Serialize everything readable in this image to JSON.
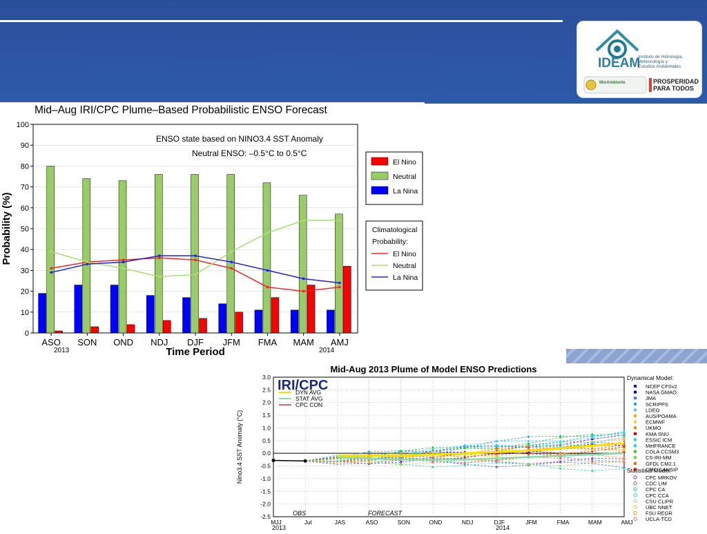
{
  "logo": {
    "org_short": "IDEAM",
    "org_long_line1": "Instituto de Hidrología,",
    "org_long_line2": "Meteorología y",
    "org_long_line3": "Estudios Ambientales",
    "ministry": "MinAmbiente",
    "slogan_line1": "PROSPERIDAD",
    "slogan_line2": "PARA TODOS"
  },
  "colors": {
    "el_nino": "#ff0000",
    "neutral": "#99cc66",
    "la_nina": "#0000ff",
    "header": "#2e56a6"
  },
  "chart_data": [
    {
      "type": "bar",
      "title": "Mid–Aug IRI/CPC Plume–Based Probabilistic ENSO Forecast",
      "xlabel": "Time Period",
      "ylabel": "Probability (%)",
      "ylim": [
        0,
        100
      ],
      "yticks": [
        "0",
        "10",
        "20",
        "30",
        "40",
        "50",
        "60",
        "70",
        "80",
        "90",
        "100"
      ],
      "categories": [
        "ASO",
        "SON",
        "OND",
        "NDJ",
        "DJF",
        "JFM",
        "FMA",
        "MAM",
        "AMJ"
      ],
      "year_labels": {
        "start": "2013",
        "end": "2014"
      },
      "annotation_line1": "ENSO state based on NINO3.4 SST Anomaly",
      "annotation_line2": "Neutral ENSO: –0.5°C to 0.5°C",
      "series": [
        {
          "name": "La Nina",
          "values": [
            19,
            23,
            23,
            18,
            17,
            14,
            11,
            11,
            11
          ]
        },
        {
          "name": "Neutral",
          "values": [
            80,
            74,
            73,
            76,
            76,
            76,
            72,
            66,
            57
          ]
        },
        {
          "name": "El Nino",
          "values": [
            1,
            3,
            4,
            6,
            7,
            10,
            17,
            23,
            32
          ]
        }
      ],
      "legend": {
        "placement": "right",
        "items": [
          "El Nino",
          "Neutral",
          "La Nina"
        ]
      },
      "climatology": {
        "legend_title_line1": "Climatological",
        "legend_title_line2": "Probability:",
        "series": [
          {
            "name": "El Nino",
            "values": [
              31,
              34,
              35,
              36,
              35,
              31,
              22,
              20,
              22
            ]
          },
          {
            "name": "Neutral",
            "values": [
              39,
              34,
              31,
              27,
              28,
              39,
              48,
              54,
              54
            ]
          },
          {
            "name": "La Nina",
            "values": [
              29,
              33,
              34,
              37,
              37,
              34,
              30,
              26,
              24
            ]
          }
        ]
      }
    },
    {
      "type": "line",
      "title": "Mid-Aug 2013 Plume of Model ENSO Predictions",
      "ylabel": "Nino3.4 SST Anomaly (°C)",
      "ylim": [
        -2.5,
        3.0
      ],
      "yticks": [
        "-2.5",
        "-2.0",
        "-1.5",
        "-1.0",
        "-0.5",
        "0.0",
        "0.5",
        "1.0",
        "1.5",
        "2.0",
        "2.5",
        "3.0"
      ],
      "categories": [
        "MJJ",
        "Jul",
        "JAS",
        "ASO",
        "SON",
        "OND",
        "NDJ",
        "DJF",
        "JFM",
        "FMA",
        "MAM",
        "AMJ"
      ],
      "year_labels": {
        "start": "2013",
        "end": "2014"
      },
      "obs_label": "OBS",
      "forecast_label": "FORECAST",
      "logo_text": "IRI/CPC",
      "avg_legend": [
        "DYN AVG",
        "STAT AVG",
        "CPC CON"
      ],
      "observed": [
        -0.28,
        -0.3
      ],
      "dyn_avg": [
        -0.1,
        -0.1,
        -0.1,
        -0.05,
        0.0,
        0.05,
        0.1,
        0.2,
        0.3,
        0.4
      ],
      "stat_avg": [
        -0.15,
        -0.2,
        -0.25,
        -0.25,
        -0.25,
        -0.2,
        -0.15,
        -0.1,
        -0.05,
        0.0
      ],
      "dynamical_title": "Dynamical Model:",
      "dynamical_models": [
        {
          "name": "NCEP CFSv2",
          "color": "#1a1ab4"
        },
        {
          "name": "NASA GMAO",
          "color": "#0000cc"
        },
        {
          "name": "JMA",
          "color": "#3a7ad8"
        },
        {
          "name": "SCRIPPS",
          "color": "#2aa0ff"
        },
        {
          "name": "LDEO",
          "color": "#55c8ff"
        },
        {
          "name": "AUS/POAMA",
          "color": "#ffaa00"
        },
        {
          "name": "ECMWF",
          "color": "#ffcc33"
        },
        {
          "name": "UKMO",
          "color": "#ff8800"
        },
        {
          "name": "KMA SNU",
          "color": "#cc0000"
        },
        {
          "name": "ESSIC ICM",
          "color": "#33ccff"
        },
        {
          "name": "MetFRANCE",
          "color": "#11ddee"
        },
        {
          "name": "COLA CCSM3",
          "color": "#33cc33"
        },
        {
          "name": "CS-IRI-MM",
          "color": "#66dd33"
        },
        {
          "name": "GFDL CM2.1",
          "color": "#ff6600"
        },
        {
          "name": "CMC CANSIP",
          "color": "#dd2200"
        }
      ],
      "statistical_title": "Statistical Model:",
      "statistical_models": [
        {
          "name": "CPC MRKOV",
          "color": "#9933cc"
        },
        {
          "name": "CDC LIM",
          "color": "#6666cc"
        },
        {
          "name": "CPC CA",
          "color": "#33aadd"
        },
        {
          "name": "CPC CCA",
          "color": "#33ddaa"
        },
        {
          "name": "CSU CLIPR",
          "color": "#99dd66"
        },
        {
          "name": "UBC NNET",
          "color": "#ddcc33"
        },
        {
          "name": "FSU REGR",
          "color": "#ff9933"
        },
        {
          "name": "UCLA-TCD",
          "color": "#ff6666"
        }
      ]
    }
  ]
}
